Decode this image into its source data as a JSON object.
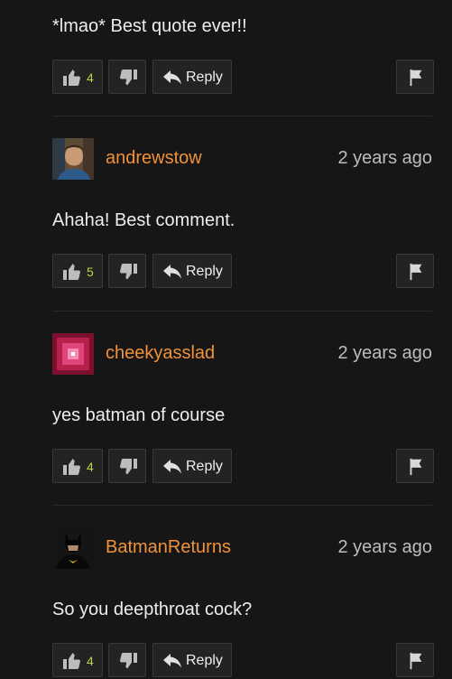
{
  "top_comment": {
    "text": "*lmao* Best quote ever!!",
    "likes": "4",
    "reply_label": "Reply"
  },
  "comments": [
    {
      "username": "andrewstow",
      "time": "2 years ago",
      "text": "Ahaha! Best comment.",
      "likes": "5",
      "reply_label": "Reply"
    },
    {
      "username": "cheekyasslad",
      "time": "2 years ago",
      "text": "yes batman of course",
      "likes": "4",
      "reply_label": "Reply"
    },
    {
      "username": "BatmanReturns",
      "time": "2 years ago",
      "text": "So you deepthroat cock?",
      "likes": "4",
      "reply_label": "Reply"
    }
  ],
  "colors": {
    "username": "#f0923a",
    "like_count": "#c2d23e",
    "background": "#161616"
  },
  "icons": {
    "like": "thumbs-up-icon",
    "dislike": "thumbs-down-icon",
    "reply": "reply-arrow-icon",
    "flag": "flag-icon"
  }
}
